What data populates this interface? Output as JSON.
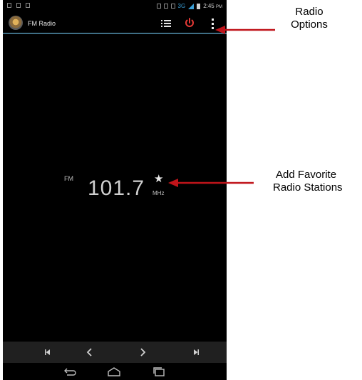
{
  "status_bar": {
    "time": "2:45",
    "am_pm": "PM",
    "network": "3G"
  },
  "app_bar": {
    "title": "FM Radio",
    "logo_icon": "radio-logo-icon",
    "list_icon": "station-list-icon",
    "power_icon": "power-icon",
    "menu_icon": "overflow-menu-icon",
    "power_color": "#e53935",
    "accent_color": "#3f6f86"
  },
  "tuner": {
    "band": "FM",
    "frequency": "101.7",
    "unit": "MHz",
    "favorite_icon": "star-icon"
  },
  "controls": {
    "icons": [
      "skip-previous-icon",
      "seek-back-icon",
      "seek-forward-icon",
      "skip-next-icon"
    ]
  },
  "navigation": {
    "icons": [
      "back-icon",
      "home-icon",
      "recents-icon"
    ]
  },
  "annotations": {
    "options_line1": "Radio",
    "options_line2": "Options",
    "favorite_line1": "Add Favorite",
    "favorite_line2": "Radio Stations",
    "arrow_color": "#c0141a"
  }
}
